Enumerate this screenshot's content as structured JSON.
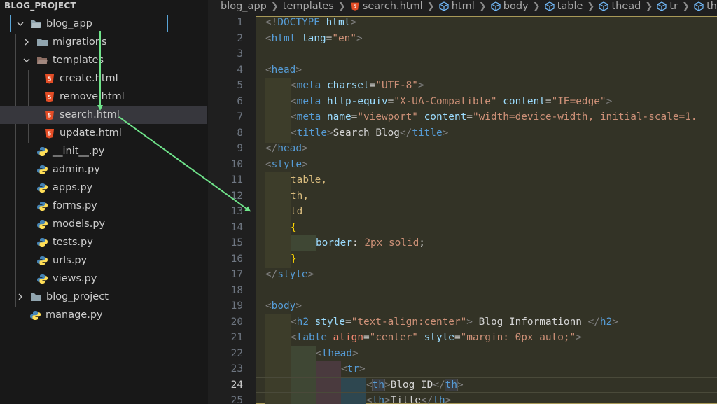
{
  "sidebar": {
    "title": "BLOG_PROJECT",
    "items": [
      {
        "label": "blog_app",
        "type": "folder-open",
        "depth": 0
      },
      {
        "label": "migrations",
        "type": "folder",
        "depth": 1
      },
      {
        "label": "templates",
        "type": "folder-open",
        "depth": 1
      },
      {
        "label": "create.html",
        "type": "html",
        "depth": 2
      },
      {
        "label": "remove.html",
        "type": "html",
        "depth": 2
      },
      {
        "label": "search.html",
        "type": "html",
        "depth": 2
      },
      {
        "label": "update.html",
        "type": "html",
        "depth": 2
      },
      {
        "label": "__init__.py",
        "type": "python",
        "depth": 1
      },
      {
        "label": "admin.py",
        "type": "python",
        "depth": 1
      },
      {
        "label": "apps.py",
        "type": "python",
        "depth": 1
      },
      {
        "label": "forms.py",
        "type": "python",
        "depth": 1
      },
      {
        "label": "models.py",
        "type": "python",
        "depth": 1
      },
      {
        "label": "tests.py",
        "type": "python",
        "depth": 1
      },
      {
        "label": "urls.py",
        "type": "python",
        "depth": 1
      },
      {
        "label": "views.py",
        "type": "python",
        "depth": 1
      },
      {
        "label": "blog_project",
        "type": "folder",
        "depth": 0
      },
      {
        "label": "manage.py",
        "type": "python",
        "depth": 0
      }
    ]
  },
  "breadcrumb": {
    "parts": [
      "blog_app",
      "templates",
      "search.html",
      "html",
      "body",
      "table",
      "thead",
      "tr",
      "th"
    ]
  },
  "editor": {
    "active_line": 24,
    "line_numbers": [
      "1",
      "2",
      "3",
      "4",
      "5",
      "6",
      "7",
      "8",
      "9",
      "10",
      "11",
      "12",
      "13",
      "14",
      "15",
      "16",
      "17",
      "18",
      "19",
      "20",
      "21",
      "22",
      "23",
      "24",
      "25"
    ]
  },
  "code": {
    "l1": {
      "a": "<!",
      "b": "DOCTYPE",
      "c": " html",
      "d": ">"
    },
    "l2": {
      "a": "<",
      "b": "html",
      "c": " lang",
      "d": "=",
      "e": "\"en\"",
      "f": ">"
    },
    "l4": {
      "a": "<",
      "b": "head",
      "c": ">"
    },
    "l5": {
      "a": "<",
      "b": "meta",
      "c": " charset",
      "d": "=",
      "e": "\"UTF-8\"",
      "f": ">"
    },
    "l6": {
      "a": "<",
      "b": "meta",
      "c": " http-equiv",
      "d": "=",
      "e": "\"X-UA-Compatible\"",
      "f": " content",
      "g": "=",
      "h": "\"IE=edge\"",
      "i": ">"
    },
    "l7": {
      "a": "<",
      "b": "meta",
      "c": " name",
      "d": "=",
      "e": "\"viewport\"",
      "f": " content",
      "g": "=",
      "h": "\"width=device-width, initial-scale=1."
    },
    "l8": {
      "a": "<",
      "b": "title",
      "c": ">",
      "d": "Search Blog",
      "e": "</",
      "f": "title",
      "g": ">"
    },
    "l9": {
      "a": "</",
      "b": "head",
      "c": ">"
    },
    "l10": {
      "a": "<",
      "b": "style",
      "c": ">"
    },
    "l11": {
      "a": "table,"
    },
    "l12": {
      "a": "th,"
    },
    "l13": {
      "a": "td"
    },
    "l14": {
      "a": "{"
    },
    "l15": {
      "a": "border",
      "b": ": ",
      "c": "2px solid",
      "d": ";"
    },
    "l16": {
      "a": "}"
    },
    "l17": {
      "a": "</",
      "b": "style",
      "c": ">"
    },
    "l19": {
      "a": "<",
      "b": "body",
      "c": ">"
    },
    "l20": {
      "a": "<",
      "b": "h2",
      "c": " style",
      "d": "=",
      "e": "\"text-align:center\"",
      "f": ">",
      "g": " Blog Informationn ",
      "h": "</",
      "i": "h2",
      "j": ">"
    },
    "l21": {
      "a": "<",
      "b": "table",
      "c": " align",
      "d": "=",
      "e": "\"center\"",
      "f": " style",
      "g": "=",
      "h": "\"margin: 0px auto;\"",
      "i": ">"
    },
    "l22": {
      "a": "<",
      "b": "thead",
      "c": ">"
    },
    "l23": {
      "a": "<",
      "b": "tr",
      "c": ">"
    },
    "l24": {
      "a": "<",
      "b": "th",
      "c": ">",
      "d": "Blog ID",
      "e": "</",
      "f": "th",
      "g": ">"
    },
    "l25": {
      "a": "<",
      "b": "th",
      "c": ">",
      "d": "Title",
      "e": "</",
      "f": "th",
      "g": ">"
    }
  },
  "colors": {
    "annotation_arrow": "#6fe38a",
    "selection_border": "#a89958",
    "focus_border": "#59a4d6"
  }
}
